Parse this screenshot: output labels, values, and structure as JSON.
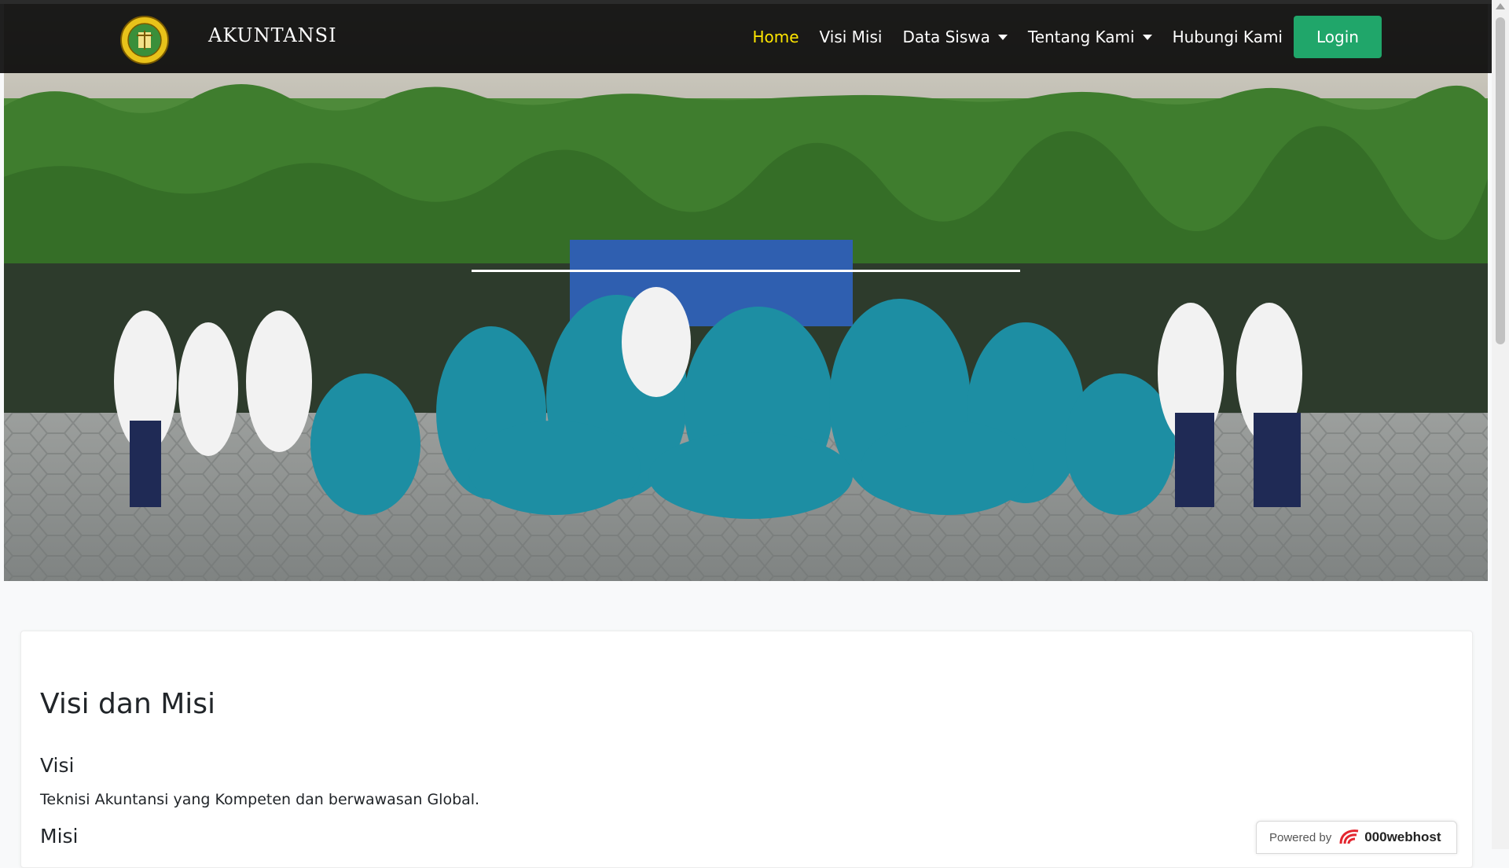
{
  "brand": {
    "name": "AKUNTANSI",
    "logo_icon": "school-emblem-icon"
  },
  "nav": {
    "items": [
      {
        "label": "Home",
        "active": true,
        "dropdown": false
      },
      {
        "label": "Visi Misi",
        "active": false,
        "dropdown": false
      },
      {
        "label": "Data Siswa",
        "active": false,
        "dropdown": true
      },
      {
        "label": "Tentang Kami",
        "active": false,
        "dropdown": true
      },
      {
        "label": "Hubungi Kami",
        "active": false,
        "dropdown": false
      }
    ],
    "login_label": "Login"
  },
  "content": {
    "title": "Visi dan Misi",
    "visi_heading": "Visi",
    "visi_text": "Teknisi Akuntansi yang Kompeten dan berwawasan Global.",
    "misi_heading": "Misi"
  },
  "badge": {
    "powered_by": "Powered by",
    "host": "000webhost"
  },
  "colors": {
    "active_nav": "#ffe600",
    "login_button": "#20a66a",
    "uniform": "#1a8fa3"
  }
}
